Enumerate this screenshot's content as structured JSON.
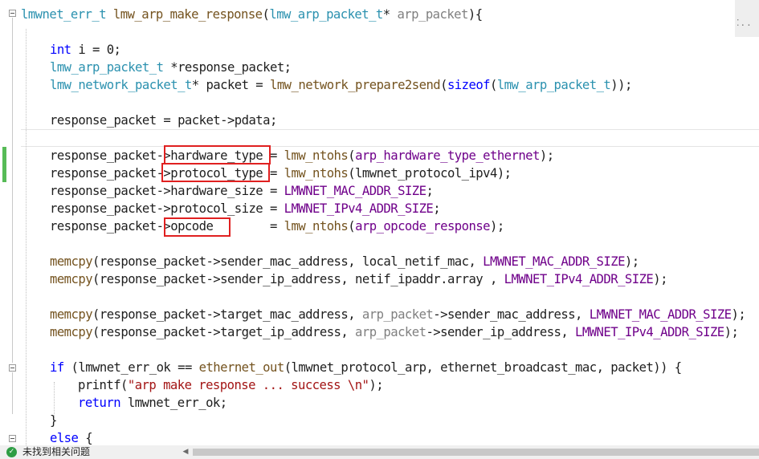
{
  "code": {
    "l1": {
      "t1": "lmwnet_err_t",
      "t2": " ",
      "t3": "lmw_arp_make_response",
      "t4": "(",
      "t5": "lmw_arp_packet_t",
      "t6": "* ",
      "t7": "arp_packet",
      "t8": "){"
    },
    "l3": {
      "t1": "int",
      "t2": " i = 0;"
    },
    "l4": {
      "t1": "lmw_arp_packet_t",
      "t2": " *response_packet;"
    },
    "l5": {
      "t1": "lmw_network_packet_t",
      "t2": "* packet = ",
      "t3": "lmw_network_prepare2send",
      "t4": "(",
      "t5": "sizeof",
      "t6": "(",
      "t7": "lmw_arp_packet_t",
      "t8": "));"
    },
    "l7": {
      "t1": "response_packet = packet->pdata;"
    },
    "l9": {
      "t1": "response_packet->hardware_type = ",
      "t2": "lmw_ntohs",
      "t3": "(",
      "t4": "arp_hardware_type_ethernet",
      "t5": ");"
    },
    "l10": {
      "t1": "response_packet->protocol_type = ",
      "t2": "lmw_ntohs",
      "t3": "(lmwnet_protocol_ipv4);"
    },
    "l11": {
      "t1": "response_packet->hardware_size = ",
      "t2": "LMWNET_MAC_ADDR_SIZE",
      "t3": ";"
    },
    "l12": {
      "t1": "response_packet->protocol_size = ",
      "t2": "LMWNET_IPv4_ADDR_SIZE",
      "t3": ";"
    },
    "l13": {
      "t1": "response_packet->opcode        = ",
      "t2": "lmw_ntohs",
      "t3": "(",
      "t4": "arp_opcode_response",
      "t5": ");"
    },
    "l15": {
      "t1": "memcpy",
      "t2": "(response_packet->sender_mac_address, local_netif_mac, ",
      "t3": "LMWNET_MAC_ADDR_SIZE",
      "t4": ");"
    },
    "l16": {
      "t1": "memcpy",
      "t2": "(response_packet->sender_ip_address, netif_ipaddr.array , ",
      "t3": "LMWNET_IPv4_ADDR_SIZE",
      "t4": ");"
    },
    "l18": {
      "t1": "memcpy",
      "t2": "(response_packet->target_mac_address, ",
      "t3": "arp_packet",
      "t4": "->sender_mac_address, ",
      "t5": "LMWNET_MAC_ADDR_SIZE",
      "t6": ");"
    },
    "l19": {
      "t1": "memcpy",
      "t2": "(response_packet->target_ip_address, ",
      "t3": "arp_packet",
      "t4": "->sender_ip_address, ",
      "t5": "LMWNET_IPv4_ADDR_SIZE",
      "t6": ");"
    },
    "l21": {
      "t1": "if",
      "t2": " (lmwnet_err_ok == ",
      "t3": "ethernet_out",
      "t4": "(lmwnet_protocol_arp, ethernet_broadcast_mac, packet)) {"
    },
    "l22": {
      "t1": "printf",
      "t2": "(",
      "t3": "\"arp make response ... success \\n\"",
      "t4": ");"
    },
    "l23": {
      "t1": "return",
      "t2": " lmwnet_err_ok;"
    },
    "l24": {
      "t1": "}"
    },
    "l25": {
      "t1": "else",
      "t2": " {"
    }
  },
  "scroll_map_glyph": "⁚..",
  "status": {
    "icon": "check-circle-icon",
    "text": "未找到相关问题"
  },
  "colors": {
    "keyword": "#0000ff",
    "type": "#2b91af",
    "function": "#74531f",
    "parameter": "#808080",
    "macro": "#6f008a",
    "string": "#a31515",
    "highlight_box": "#e02020",
    "change_bar": "#57bb57"
  }
}
